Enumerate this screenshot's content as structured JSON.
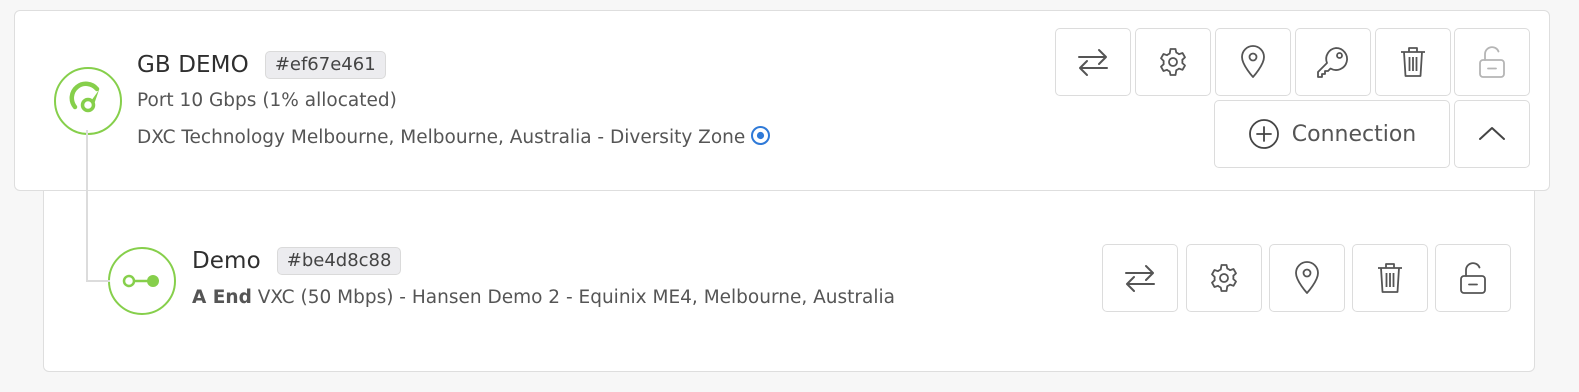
{
  "port": {
    "name": "GB DEMO",
    "uid": "#ef67e461",
    "speed_line": "Port 10 Gbps (1% allocated)",
    "location_line": "DXC Technology Melbourne, Melbourne, Australia - Diversity Zone",
    "status_color": "#86cf4b",
    "diversity_color": "#2f7ad8",
    "actions": [
      {
        "name": "transfer-icon"
      },
      {
        "name": "gear-icon"
      },
      {
        "name": "map-pin-icon"
      },
      {
        "name": "key-icon"
      },
      {
        "name": "trash-icon"
      },
      {
        "name": "unlock-icon"
      }
    ],
    "add_connection_label": "Connection",
    "collapse_icon": "chevron-up-icon"
  },
  "vxc": {
    "name": "Demo",
    "uid": "#be4d8c88",
    "end_label": "A End",
    "description": "VXC (50 Mbps) - Hansen Demo 2 - Equinix ME4, Melbourne, Australia",
    "status_color": "#86cf4b",
    "actions": [
      {
        "name": "transfer-icon"
      },
      {
        "name": "gear-icon"
      },
      {
        "name": "map-pin-icon"
      },
      {
        "name": "trash-icon"
      },
      {
        "name": "unlock-icon"
      }
    ]
  }
}
